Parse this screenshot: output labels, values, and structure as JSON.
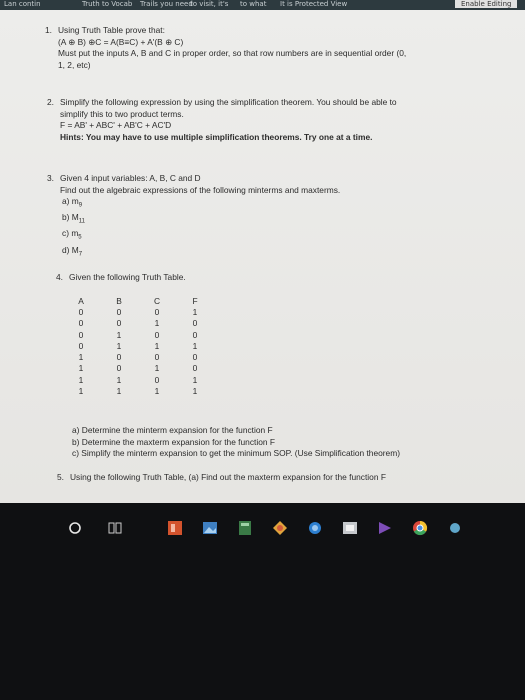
{
  "top_strip": [
    "Lan contin",
    "Truth to Vocab",
    "Trails you need",
    "to visit, it's",
    "to what",
    "It is Protected View",
    "Enable Editing"
  ],
  "questions": {
    "q1": {
      "number": "1.",
      "title": "Using Truth Table prove that:",
      "expression": "(A ⊕ B) ⊕C = A(B≡C) + A'(B ⊕ C)",
      "note": "Must put the inputs A, B and C in proper order, so that row numbers are in sequential order (0,",
      "note2": "1, 2, etc)"
    },
    "q2": {
      "number": "2.",
      "line1": "Simplify the following expression by using the simplification theorem. You should be able to",
      "line2": "simplify this to two product terms.",
      "expression": "F = AB' + ABC' + AB'C + AC'D",
      "hint": "Hints: You may have to use multiple simplification theorems. Try one at a time."
    },
    "q3": {
      "number": "3.",
      "line1": "Given 4 input variables: A, B, C and D",
      "line2": "Find out the algebraic expressions of the following minterms and maxterms.",
      "items": [
        {
          "label": "a)",
          "var": "m",
          "sub": "9"
        },
        {
          "label": "b)",
          "var": "M",
          "sub": "11"
        },
        {
          "label": "c)",
          "var": "m",
          "sub": "5"
        },
        {
          "label": "d)",
          "var": "M",
          "sub": "7"
        }
      ]
    },
    "q4": {
      "number": "4.",
      "title": "Given the following Truth Table.",
      "headers": [
        "A",
        "B",
        "C",
        "F"
      ],
      "rows": [
        [
          "0",
          "0",
          "0",
          "1"
        ],
        [
          "0",
          "0",
          "1",
          "0"
        ],
        [
          "0",
          "1",
          "0",
          "0"
        ],
        [
          "0",
          "1",
          "1",
          "1"
        ],
        [
          "1",
          "0",
          "0",
          "0"
        ],
        [
          "1",
          "0",
          "1",
          "0"
        ],
        [
          "1",
          "1",
          "0",
          "1"
        ],
        [
          "1",
          "1",
          "1",
          "1"
        ]
      ],
      "parts": [
        "a)  Determine the minterm expansion for the function F",
        "b)  Determine the maxterm expansion for the function F",
        "c)  Simplify the minterm expansion to get the minimum SOP. (Use Simplification theorem)"
      ]
    },
    "q5": {
      "number": "5.",
      "text": "Using the following Truth Table, (a) Find out the maxterm expansion for the function F"
    }
  },
  "taskbar": {
    "items": [
      "cortana-icon",
      "task-view-icon",
      "powerpoint-icon",
      "photos-icon",
      "calculator-icon",
      "color-app-icon",
      "onedrive-icon",
      "store-icon",
      "visual-studio-icon",
      "chrome-icon",
      "settings-icon"
    ]
  }
}
